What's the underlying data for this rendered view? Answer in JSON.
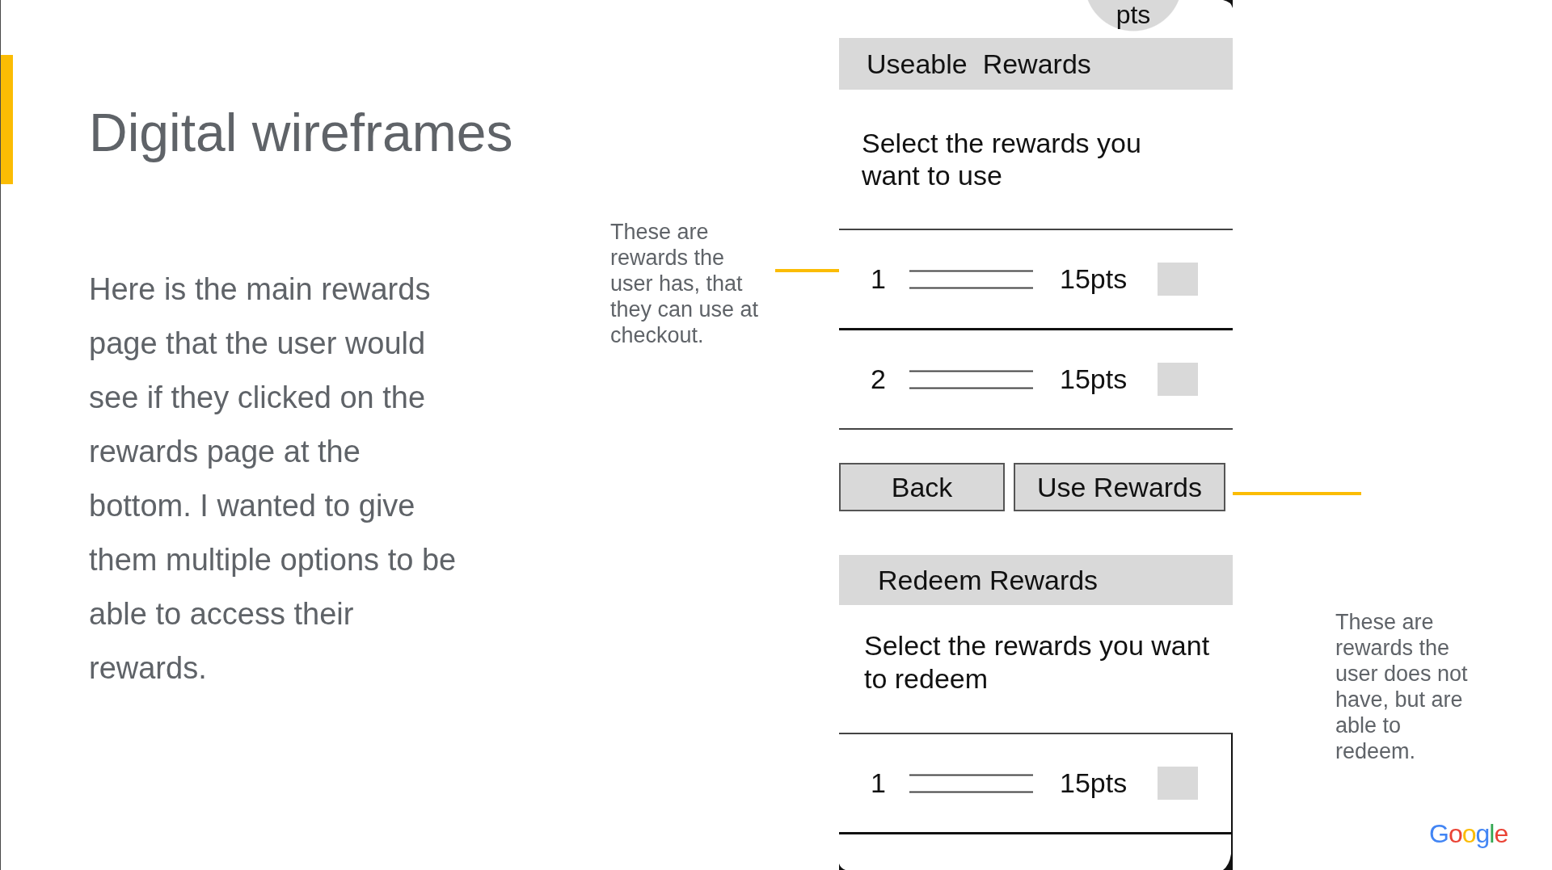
{
  "slide": {
    "title": "Digital wireframes",
    "body": "Here is the main rewards page that the user would see if they clicked on the rewards page at the bottom. I wanted to give them multiple options to be able to access their rewards."
  },
  "annotations": [
    {
      "text": "These are rewards the user has, that they can use at checkout."
    },
    {
      "text": "These are rewards the user does not have, but are able to redeem."
    }
  ],
  "wireframe": {
    "points_circle": {
      "label": "pts"
    },
    "sections": [
      {
        "title": "Useable  Rewards",
        "description": "Select the rewards you want to use",
        "rows": [
          {
            "number": "1",
            "points": "15pts",
            "checked": false
          },
          {
            "number": "2",
            "points": "15pts",
            "checked": false
          }
        ],
        "buttons": [
          "Back",
          "Use Rewards"
        ]
      },
      {
        "title": "Redeem Rewards",
        "description": "Select the rewards you want to redeem",
        "rows": [
          {
            "number": "1",
            "points": "15pts",
            "checked": false
          }
        ]
      }
    ]
  },
  "logo": {
    "text": "Google"
  }
}
